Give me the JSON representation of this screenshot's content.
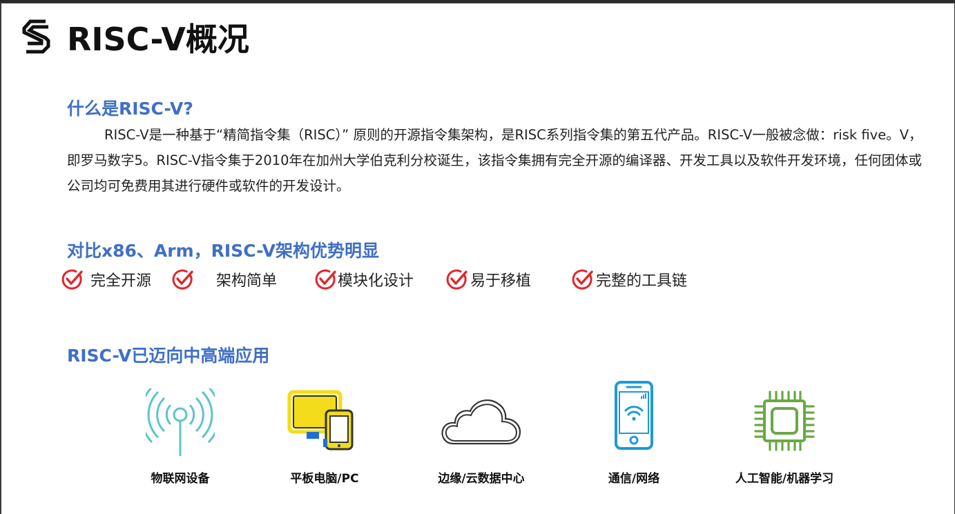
{
  "slide": {
    "title": "RISC-V概况",
    "logo_icon": "stacked-s-logo-icon"
  },
  "section1": {
    "heading": "什么是RISC-V?",
    "paragraph": "RISC-V是一种基于“精简指令集（RISC）” 原则的开源指令集架构，是RISC系列指令集的第五代产品。RISC-V一般被念做：risk five。V，即罗马数字5。RISC-V指令集于2010年在加州大学伯克利分校诞生，该指令集拥有完全开源的编译器、开发工具以及软件开发环境，任何团体或公司均可免费用其进行硬件或软件的开发设计。"
  },
  "section2": {
    "heading": "对比x86、Arm，RISC-V架构优势明显",
    "check_icon": "red-check-circle-icon",
    "check_color": "#e0262b",
    "items": [
      {
        "label": "完全开源"
      },
      {
        "label": "架构简单"
      },
      {
        "label": "模块化设计"
      },
      {
        "label": "易于移植"
      },
      {
        "label": "完整的工具链"
      }
    ]
  },
  "section3": {
    "heading": "RISC-V已迈向中高端应用",
    "apps": [
      {
        "label": "物联网设备",
        "icon": "antenna-signal-icon",
        "color": "#5ec3c9"
      },
      {
        "label": "平板电脑/PC",
        "icon": "monitor-tablet-icon",
        "color": "#f2dc1b"
      },
      {
        "label": "边缘/云数据中心",
        "icon": "cloud-icon",
        "color": "#333333"
      },
      {
        "label": "通信/网络",
        "icon": "smartphone-wifi-icon",
        "color": "#1e9ad6"
      },
      {
        "label": "人工智能/机器学习",
        "icon": "chip-icon",
        "color": "#6aa843"
      }
    ]
  },
  "colors": {
    "heading_blue": "#3f6fc6",
    "text": "#222222"
  }
}
